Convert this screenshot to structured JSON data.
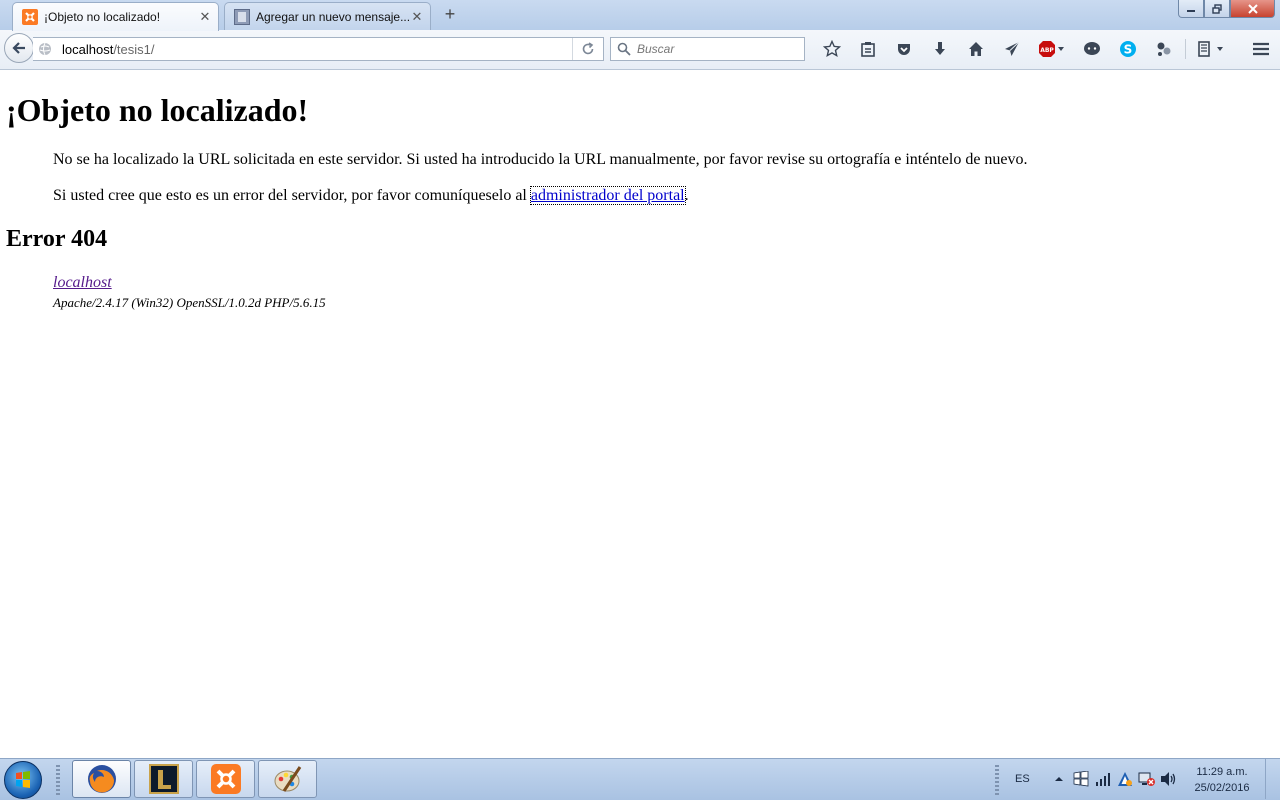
{
  "browser": {
    "tabs": [
      {
        "title": "¡Objeto no localizado!",
        "active": true
      },
      {
        "title": "Agregar un nuevo mensaje...",
        "active": false
      }
    ],
    "close_glyph": "✕",
    "new_tab_glyph": "+",
    "url": {
      "host": "localhost",
      "path": "/tesis1/"
    },
    "search_placeholder": "Buscar"
  },
  "page": {
    "title": "¡Objeto no localizado!",
    "paragraph1": "No se ha localizado la URL solicitada en este servidor. Si usted ha introducido la URL manualmente, por favor revise su ortografía e inténtelo de nuevo.",
    "paragraph2_prefix": "Si usted cree que esto es un error del servidor, por favor comuníqueselo al ",
    "paragraph2_link": "administrador del portal",
    "paragraph2_suffix": ".",
    "error_heading": "Error 404",
    "address_link": "localhost",
    "server_signature": "Apache/2.4.17 (Win32) OpenSSL/1.0.2d PHP/5.6.15"
  },
  "taskbar": {
    "apps": [
      "firefox-icon",
      "league-of-legends-icon",
      "xampp-icon",
      "paint-icon"
    ],
    "language": "ES",
    "time": "11:29 a.m.",
    "date": "25/02/2016"
  },
  "colors": {
    "link": "#0000cc",
    "visited_link": "#551a8b",
    "xampp_orange": "#fb7a24",
    "abp_red": "#c70d0d",
    "skype_blue": "#00aff0"
  }
}
